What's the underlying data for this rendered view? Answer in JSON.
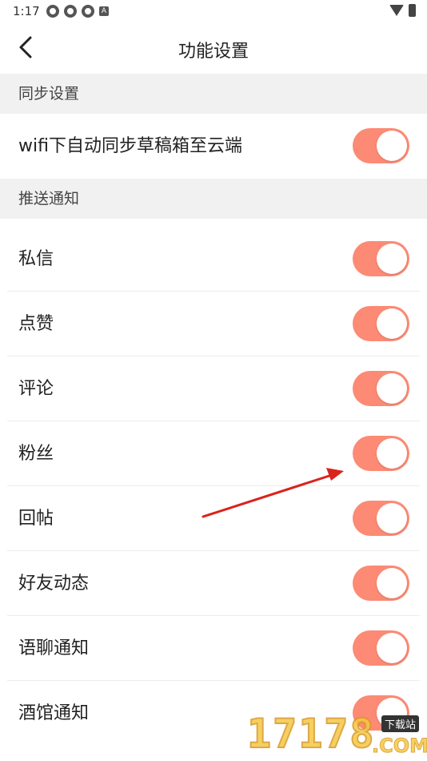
{
  "status_bar": {
    "time": "1:17",
    "notification_icons": [
      "sync-icon",
      "sync-icon",
      "sync-icon",
      "a-icon"
    ],
    "a_icon_letter": "A"
  },
  "header": {
    "title": "功能设置"
  },
  "sections": {
    "sync": {
      "title": "同步设置",
      "items": [
        {
          "label": "wifi下自动同步草稿箱至云端",
          "enabled": true
        }
      ]
    },
    "push": {
      "title": "推送通知",
      "items": [
        {
          "label": "私信",
          "enabled": true
        },
        {
          "label": "点赞",
          "enabled": true
        },
        {
          "label": "评论",
          "enabled": true
        },
        {
          "label": "粉丝",
          "enabled": true
        },
        {
          "label": "回帖",
          "enabled": true
        },
        {
          "label": "好友动态",
          "enabled": true
        },
        {
          "label": "语聊通知",
          "enabled": true
        },
        {
          "label": "酒馆通知",
          "enabled": true
        }
      ]
    }
  },
  "colors": {
    "toggle_on": "#fc8a74",
    "section_bg": "#f1f1f2",
    "annotation_arrow": "#d9231d"
  },
  "watermark": {
    "digits": "17178",
    "badge": "下载站",
    "suffix": ".COM"
  }
}
